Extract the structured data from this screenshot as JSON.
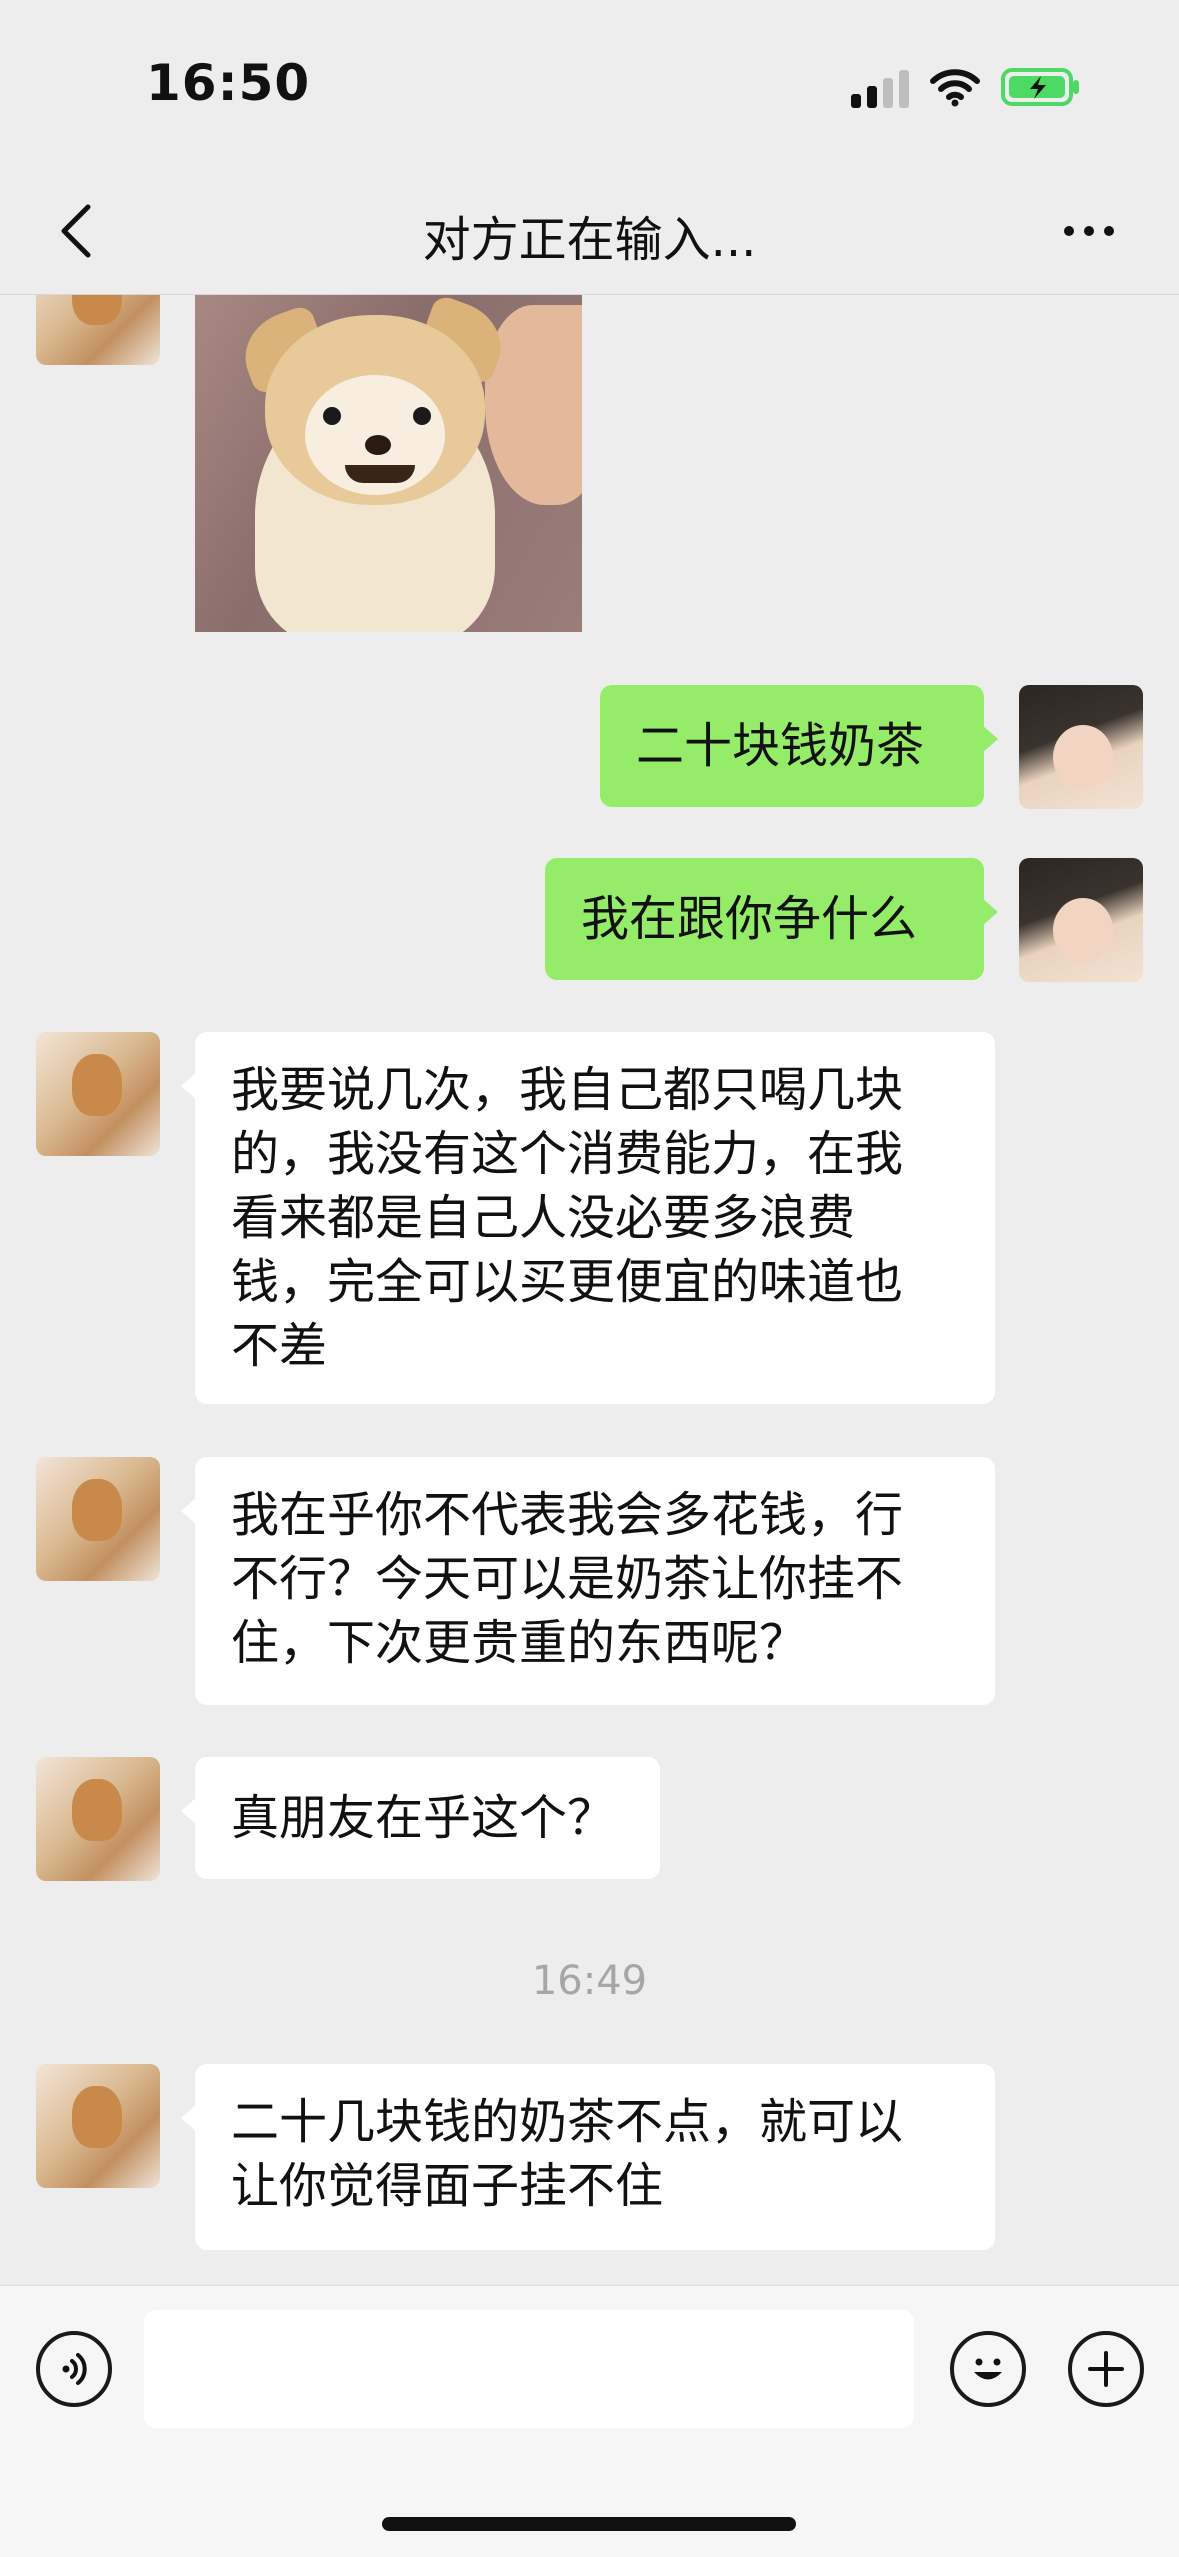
{
  "status_bar": {
    "time": "16:50",
    "icons": [
      "cellular-signal-icon",
      "wifi-icon",
      "battery-charging-icon"
    ]
  },
  "nav": {
    "back_icon": "chevron-left-icon",
    "title": "对方正在输入...",
    "more_icon": "more-dots-icon"
  },
  "messages": [
    {
      "sender": "them",
      "type": "image",
      "content": "puppy-sticker-image"
    },
    {
      "sender": "me",
      "type": "text",
      "text": "二十块钱奶茶"
    },
    {
      "sender": "me",
      "type": "text",
      "text": "我在跟你争什么"
    },
    {
      "sender": "them",
      "type": "text",
      "lines": [
        "我要说几次，我自己都只喝几块",
        "的，我没有这个消费能力，在我",
        "看来都是自己人没必要多浪费",
        "钱，完全可以买更便宜的味道也",
        "不差"
      ]
    },
    {
      "sender": "them",
      "type": "text",
      "lines": [
        "我在乎你不代表我会多花钱，行",
        "不行？今天可以是奶茶让你挂不",
        "住，下次更贵重的东西呢？"
      ]
    },
    {
      "sender": "them",
      "type": "text",
      "text": "真朋友在乎这个？"
    },
    {
      "type": "timestamp",
      "text": "16:49"
    },
    {
      "sender": "them",
      "type": "text",
      "lines": [
        "二十几块钱的奶茶不点，就可以",
        "让你觉得面子挂不住"
      ]
    }
  ],
  "input_bar": {
    "voice_icon": "voice-icon",
    "input_value": "",
    "emoji_icon": "emoji-icon",
    "plus_icon": "plus-icon"
  },
  "colors": {
    "background": "#ededed",
    "my_bubble": "#95ec69",
    "their_bubble": "#ffffff",
    "battery_charge": "#4cd964"
  }
}
